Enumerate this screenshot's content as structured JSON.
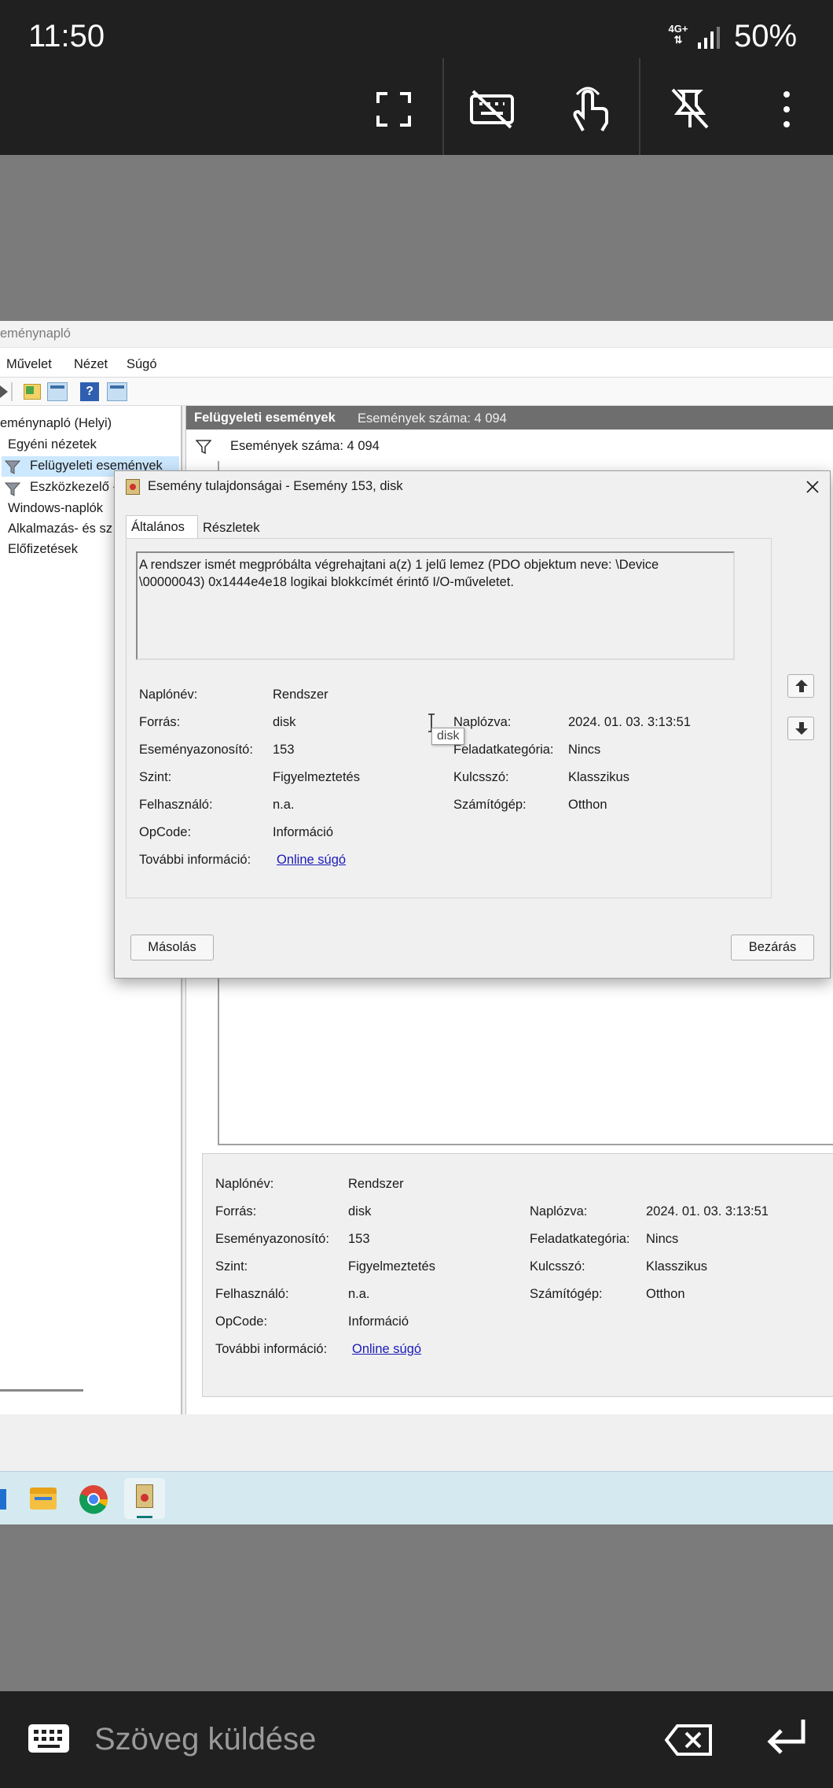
{
  "status": {
    "time": "11:50",
    "network": "4G+",
    "battery": "50%"
  },
  "app": {
    "title": "eménynapló",
    "menu": [
      "Művelet",
      "Nézet",
      "Súgó"
    ],
    "tree": [
      "eménynapló (Helyi)",
      "Egyéni nézetek",
      "Felügyeleti események",
      "Eszközkezelő -",
      "Windows-naplók",
      "Alkalmazás- és sz",
      "Előfizetések"
    ],
    "header": {
      "title": "Felügyeleti események",
      "count": "Események száma: 4 094"
    },
    "filter_count": "Események száma: 4 094"
  },
  "dialog": {
    "title": "Esemény tulajdonságai - Esemény 153, disk",
    "tabs": [
      "Általános",
      "Részletek"
    ],
    "message": "A rendszer ismét megpróbálta végrehajtani a(z) 1 jelű lemez (PDO objektum neve: \\Device\n\\00000043) 0x1444e4e18 logikai blokkcímét érintő I/O-műveletet.",
    "tooltip": "disk",
    "fields": {
      "log_name_label": "Naplónév:",
      "log_name": "Rendszer",
      "source_label": "Forrás:",
      "source": "disk",
      "logged_label": "Naplózva:",
      "logged": "2024. 01. 03. 3:13:51",
      "event_id_label": "Eseményazonosító:",
      "event_id": "153",
      "task_label": "Feladatkategória:",
      "task": "Nincs",
      "level_label": "Szint:",
      "level": "Figyelmeztetés",
      "keyword_label": "Kulcsszó:",
      "keyword": "Klasszikus",
      "user_label": "Felhasználó:",
      "user": "n.a.",
      "computer_label": "Számítógép:",
      "computer": "Otthon",
      "opcode_label": "OpCode:",
      "opcode": "Információ",
      "more_label": "További információ:",
      "more_link": "Online súgó"
    },
    "copy_button": "Másolás",
    "close_button": "Bezárás"
  },
  "input": {
    "placeholder": "Szöveg küldése"
  }
}
